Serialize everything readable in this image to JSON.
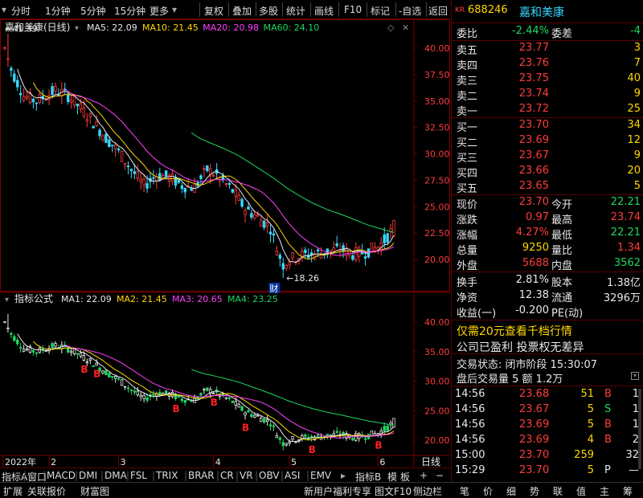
{
  "toolbar": {
    "left_items": [
      "分时",
      "1分钟",
      "5分钟",
      "15分钟",
      "更多"
    ],
    "right_items": [
      "复权",
      "叠加",
      "多股",
      "统计",
      "画线",
      "F10",
      "标记",
      "-自选",
      "返回"
    ]
  },
  "kchart": {
    "title": "嘉和美康(日线)",
    "ma_labels": [
      {
        "text": "MA5: 22.09",
        "color": "#e8e8e8"
      },
      {
        "text": "MA10: 21.45",
        "color": "#ffd700"
      },
      {
        "text": "MA20: 20.98",
        "color": "#ff40ff"
      },
      {
        "text": "MA60: 24.10",
        "color": "#1ed760"
      }
    ],
    "high_label": "41.39",
    "low_label": "18.26",
    "cai_label": "财",
    "y_ticks": [
      "40.00",
      "37.50",
      "35.00",
      "32.50",
      "30.00",
      "27.50",
      "25.00",
      "22.50",
      "20.00"
    ]
  },
  "indicator": {
    "title": "指标公式",
    "ma_labels": [
      {
        "text": "MA1: 22.09",
        "color": "#e8e8e8"
      },
      {
        "text": "MA2: 21.45",
        "color": "#ffd700"
      },
      {
        "text": "MA3: 20.65",
        "color": "#ff40ff"
      },
      {
        "text": "MA4: 23.25",
        "color": "#1ed760"
      }
    ],
    "y_ticks": [
      "40.00",
      "35.00",
      "30.00",
      "25.00",
      "20.00"
    ],
    "markers": [
      "B",
      "B",
      "B",
      "B",
      "B",
      "B",
      "B"
    ]
  },
  "dates": [
    "2022年",
    "2",
    "3",
    "4",
    "5",
    "6"
  ],
  "period_label": "日线",
  "bottom_tabs": [
    "指标A",
    "窗口",
    "MACD",
    "DMI",
    "DMA",
    "FSL",
    "TRIX",
    "BRAR",
    "CR",
    "VR",
    "OBV",
    "ASI",
    "EMV"
  ],
  "bottom_right": [
    "指标B",
    "模",
    "板"
  ],
  "status_tabs": [
    "扩展",
    "关联报价",
    "财富图"
  ],
  "status_right": [
    "新用户福利专享",
    "图文F10",
    "侧边栏"
  ],
  "side_tabs": [
    "笔",
    "价",
    "细",
    "势",
    "联",
    "值",
    "主",
    "筹"
  ],
  "stock": {
    "kr": "KR",
    "code": "688246",
    "name": "嘉和美康"
  },
  "weibi": {
    "label": "委比",
    "value": "-2.44%",
    "label2": "委差",
    "value2": "-4"
  },
  "asks": [
    {
      "label": "卖五",
      "price": "23.77",
      "vol": "3"
    },
    {
      "label": "卖四",
      "price": "23.76",
      "vol": "7"
    },
    {
      "label": "卖三",
      "price": "23.75",
      "vol": "40"
    },
    {
      "label": "卖二",
      "price": "23.74",
      "vol": "9"
    },
    {
      "label": "卖一",
      "price": "23.72",
      "vol": "25"
    }
  ],
  "bids": [
    {
      "label": "买一",
      "price": "23.70",
      "vol": "34"
    },
    {
      "label": "买二",
      "price": "23.69",
      "vol": "12"
    },
    {
      "label": "买三",
      "price": "23.67",
      "vol": "9"
    },
    {
      "label": "买四",
      "price": "23.66",
      "vol": "20"
    },
    {
      "label": "买五",
      "price": "23.65",
      "vol": "5"
    }
  ],
  "quote": [
    {
      "l1": "现价",
      "v1": "23.70",
      "c1": "#ff3c3c",
      "l2": "今开",
      "v2": "22.21",
      "c2": "#1ed760"
    },
    {
      "l1": "涨跌",
      "v1": "0.97",
      "c1": "#ff3c3c",
      "l2": "最高",
      "v2": "23.74",
      "c2": "#ff3c3c"
    },
    {
      "l1": "涨幅",
      "v1": "4.27%",
      "c1": "#ff3c3c",
      "l2": "最低",
      "v2": "22.21",
      "c2": "#1ed760"
    },
    {
      "l1": "总量",
      "v1": "9250",
      "c1": "#ffd700",
      "l2": "量比",
      "v2": "1.34",
      "c2": "#ff3c3c"
    },
    {
      "l1": "外盘",
      "v1": "5688",
      "c1": "#ff3c3c",
      "l2": "内盘",
      "v2": "3562",
      "c2": "#1ed760"
    }
  ],
  "quote2": [
    {
      "l1": "换手",
      "v1": "2.81%",
      "l2": "股本",
      "v2": "1.38亿"
    },
    {
      "l1": "净资",
      "v1": "12.38",
      "l2": "流通",
      "v2": "3296万"
    },
    {
      "l1": "收益(一)",
      "v1": "-0.200",
      "l2": "PE(动)",
      "v2": ""
    }
  ],
  "promo": "仅需20元查看千档行情",
  "notice": "公司已盈利 投票权无差异",
  "trade_status": "交易状态: 闭市阶段 15:30:07",
  "after_hours": "盘后交易量 5 额 1.2万",
  "ticks": [
    {
      "time": "14:56",
      "price": "23.68",
      "pc": "#ff3c3c",
      "vol": "51",
      "dir": "B",
      "dc": "#ff3c3c",
      "n": "1"
    },
    {
      "time": "14:56",
      "price": "23.67",
      "pc": "#ff3c3c",
      "vol": "5",
      "dir": "S",
      "dc": "#1ed760",
      "n": "1"
    },
    {
      "time": "14:56",
      "price": "23.69",
      "pc": "#ff3c3c",
      "vol": "5",
      "dir": "B",
      "dc": "#ff3c3c",
      "n": "1"
    },
    {
      "time": "14:56",
      "price": "23.69",
      "pc": "#ff3c3c",
      "vol": "4",
      "dir": "B",
      "dc": "#ff3c3c",
      "n": "2"
    },
    {
      "time": "15:00",
      "price": "23.70",
      "pc": "#ff3c3c",
      "vol": "259",
      "dir": "",
      "dc": "#ff3c3c",
      "n": "32"
    },
    {
      "time": "15:29",
      "price": "23.70",
      "pc": "#ff3c3c",
      "vol": "5",
      "dir": "P",
      "dc": "#e8e8e8",
      "n": "—"
    }
  ]
}
